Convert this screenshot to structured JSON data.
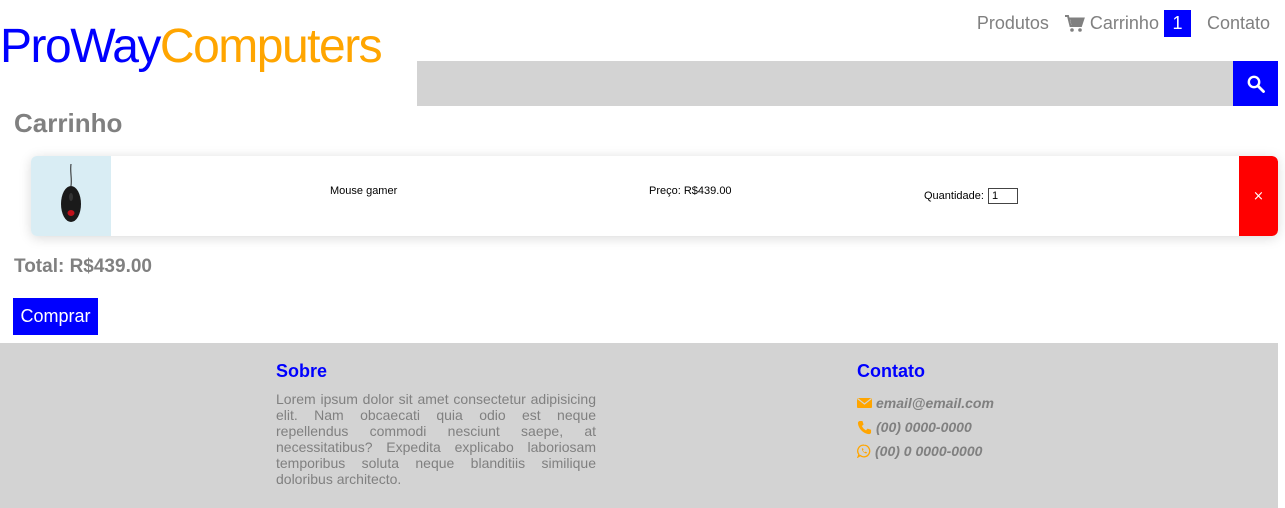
{
  "brand": {
    "part1": "ProWay",
    "part2": "Computers",
    "color1": "#0000ff",
    "color2": "#ffa500"
  },
  "nav": {
    "products": "Produtos",
    "cart": "Carrinho",
    "cart_count": "1",
    "contact": "Contato",
    "cart_icon": "cart-icon"
  },
  "search": {
    "placeholder": "",
    "value": "",
    "icon": "search-icon"
  },
  "cart_title": "Carrinho",
  "items": [
    {
      "name": "Mouse gamer",
      "price": "Preço: R$439.00",
      "qty_label": "Quantidade:",
      "qty": "1",
      "remove_label": "×",
      "image_icon": "mouse-icon"
    }
  ],
  "total": "Total: R$439.00",
  "buy_label": "Comprar",
  "footer": {
    "about_title": "Sobre",
    "about_text": "Lorem ipsum dolor sit amet consectetur adipisicing elit. Nam obcaecati quia odio est neque repellendus commodi nesciunt saepe, at necessitatibus? Expedita explicabo laboriosam temporibus soluta neque blanditiis similique doloribus architecto.",
    "contact_title": "Contato",
    "email": "email@email.com",
    "phone": "(00) 0000-0000",
    "whatsapp": "(00) 0 0000-0000"
  },
  "colors": {
    "accent": "#0000ff",
    "danger": "#ff0000",
    "icon": "#ffa500",
    "muted": "#808080",
    "footer_bg": "#d3d3d3"
  }
}
